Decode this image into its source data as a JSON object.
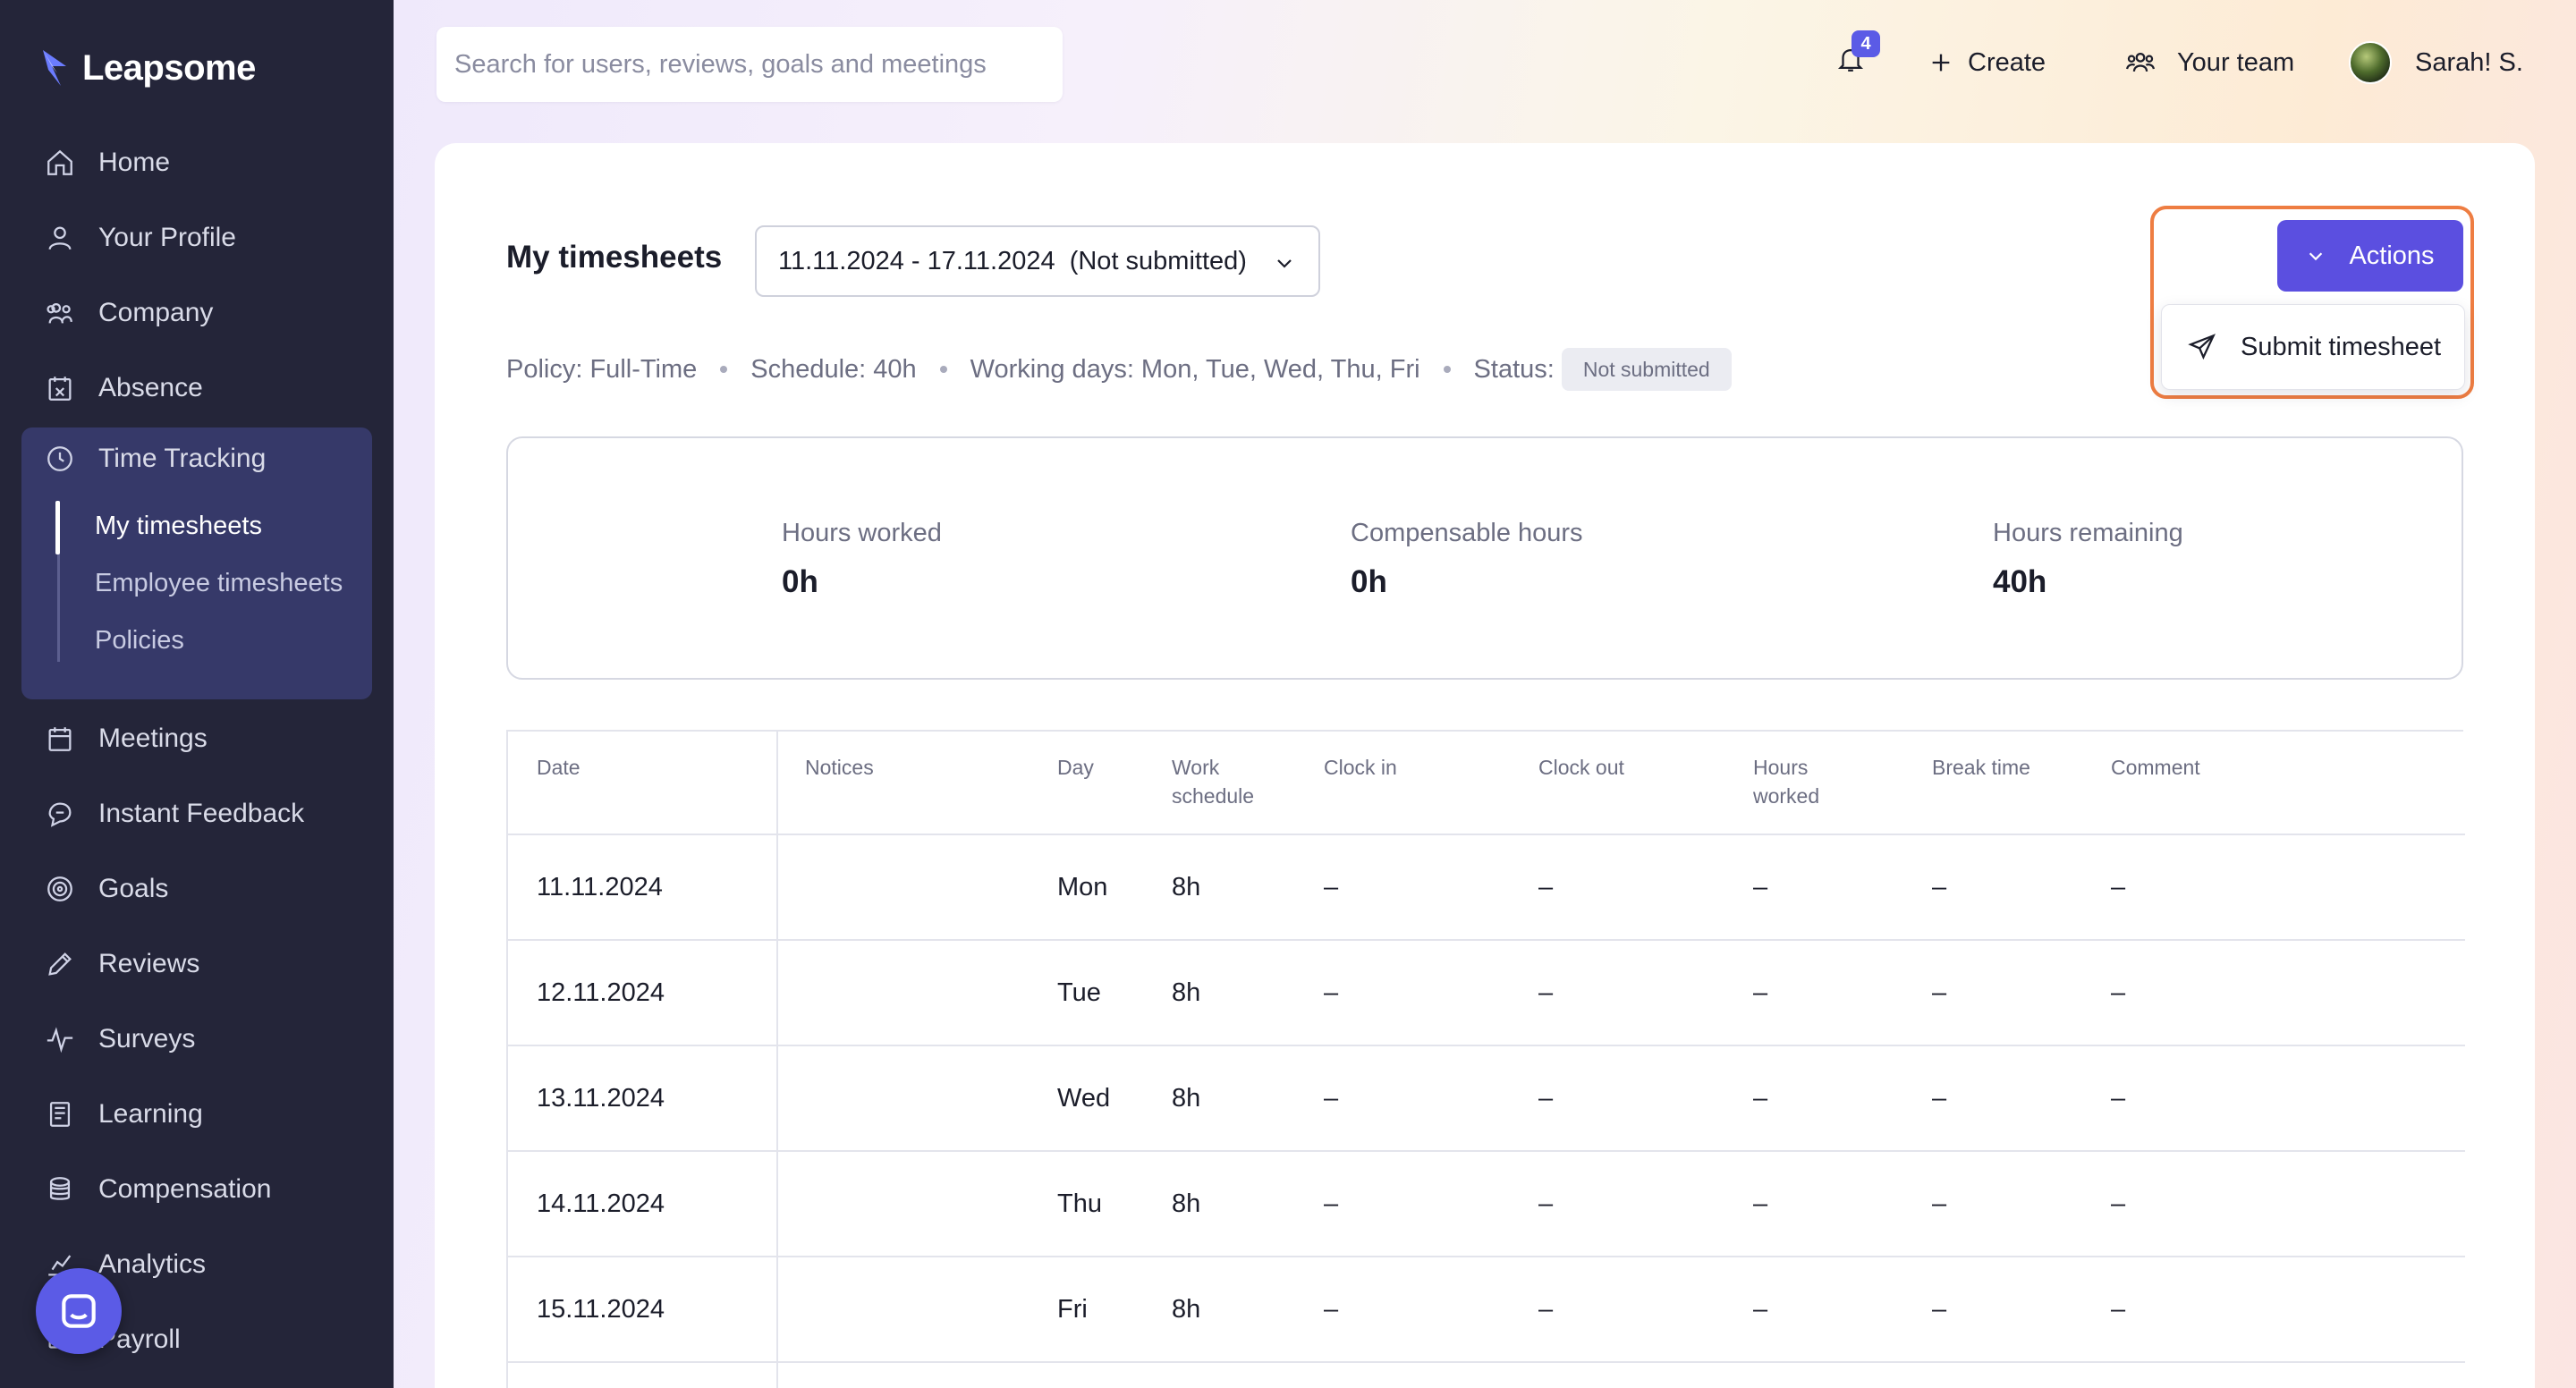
{
  "brand": {
    "name": "Leapsome"
  },
  "sidebar": {
    "items": [
      {
        "label": "Home",
        "icon": "home-icon"
      },
      {
        "label": "Your Profile",
        "icon": "user-icon"
      },
      {
        "label": "Company",
        "icon": "users-icon"
      },
      {
        "label": "Absence",
        "icon": "calendar-x-icon"
      },
      {
        "label": "Time Tracking",
        "icon": "clock-icon"
      },
      {
        "label": "Meetings",
        "icon": "calendar-icon"
      },
      {
        "label": "Instant Feedback",
        "icon": "chat-icon"
      },
      {
        "label": "Goals",
        "icon": "target-icon"
      },
      {
        "label": "Reviews",
        "icon": "pencil-icon"
      },
      {
        "label": "Surveys",
        "icon": "pulse-icon"
      },
      {
        "label": "Learning",
        "icon": "book-icon"
      },
      {
        "label": "Compensation",
        "icon": "coins-icon"
      },
      {
        "label": "Analytics",
        "icon": "chart-icon"
      },
      {
        "label": "Payroll",
        "icon": "payroll-icon"
      }
    ],
    "time_tracking_sub": [
      {
        "label": "My timesheets",
        "active": true
      },
      {
        "label": "Employee timesheets",
        "active": false
      },
      {
        "label": "Policies",
        "active": false
      }
    ]
  },
  "header": {
    "search_placeholder": "Search for users, reviews, goals and meetings",
    "notification_count": "4",
    "create_label": "Create",
    "team_label": "Your team",
    "user_name": "Sarah! S."
  },
  "page": {
    "title": "My timesheets",
    "period": "11.11.2024 - 17.11.2024  (Not submitted)",
    "policy": "Policy: Full-Time",
    "schedule": "Schedule: 40h",
    "working_days": "Working days: Mon, Tue, Wed, Thu, Fri",
    "status_label": "Status:",
    "status_value": "Not submitted",
    "actions_label": "Actions",
    "submit_label": "Submit timesheet"
  },
  "summary": {
    "hours_worked_label": "Hours worked",
    "hours_worked_value": "0h",
    "compensable_label": "Compensable hours",
    "compensable_value": "0h",
    "remaining_label": "Hours remaining",
    "remaining_value": "40h"
  },
  "table": {
    "headers": [
      "Date",
      "Notices",
      "Day",
      "Work schedule",
      "Clock in",
      "Clock out",
      "Hours worked",
      "Break time",
      "Comment"
    ],
    "rows": [
      {
        "date": "11.11.2024",
        "notices": "",
        "day": "Mon",
        "schedule": "8h",
        "clock_in": "–",
        "clock_out": "–",
        "hours": "–",
        "break": "–",
        "comment": "–"
      },
      {
        "date": "12.11.2024",
        "notices": "",
        "day": "Tue",
        "schedule": "8h",
        "clock_in": "–",
        "clock_out": "–",
        "hours": "–",
        "break": "–",
        "comment": "–"
      },
      {
        "date": "13.11.2024",
        "notices": "",
        "day": "Wed",
        "schedule": "8h",
        "clock_in": "–",
        "clock_out": "–",
        "hours": "–",
        "break": "–",
        "comment": "–"
      },
      {
        "date": "14.11.2024",
        "notices": "",
        "day": "Thu",
        "schedule": "8h",
        "clock_in": "–",
        "clock_out": "–",
        "hours": "–",
        "break": "–",
        "comment": "–"
      },
      {
        "date": "15.11.2024",
        "notices": "",
        "day": "Fri",
        "schedule": "8h",
        "clock_in": "–",
        "clock_out": "–",
        "hours": "–",
        "break": "–",
        "comment": "–"
      }
    ]
  },
  "colors": {
    "sidebar_bg": "#242539",
    "accent": "#5b4fe0",
    "highlight": "#ee7d42"
  }
}
